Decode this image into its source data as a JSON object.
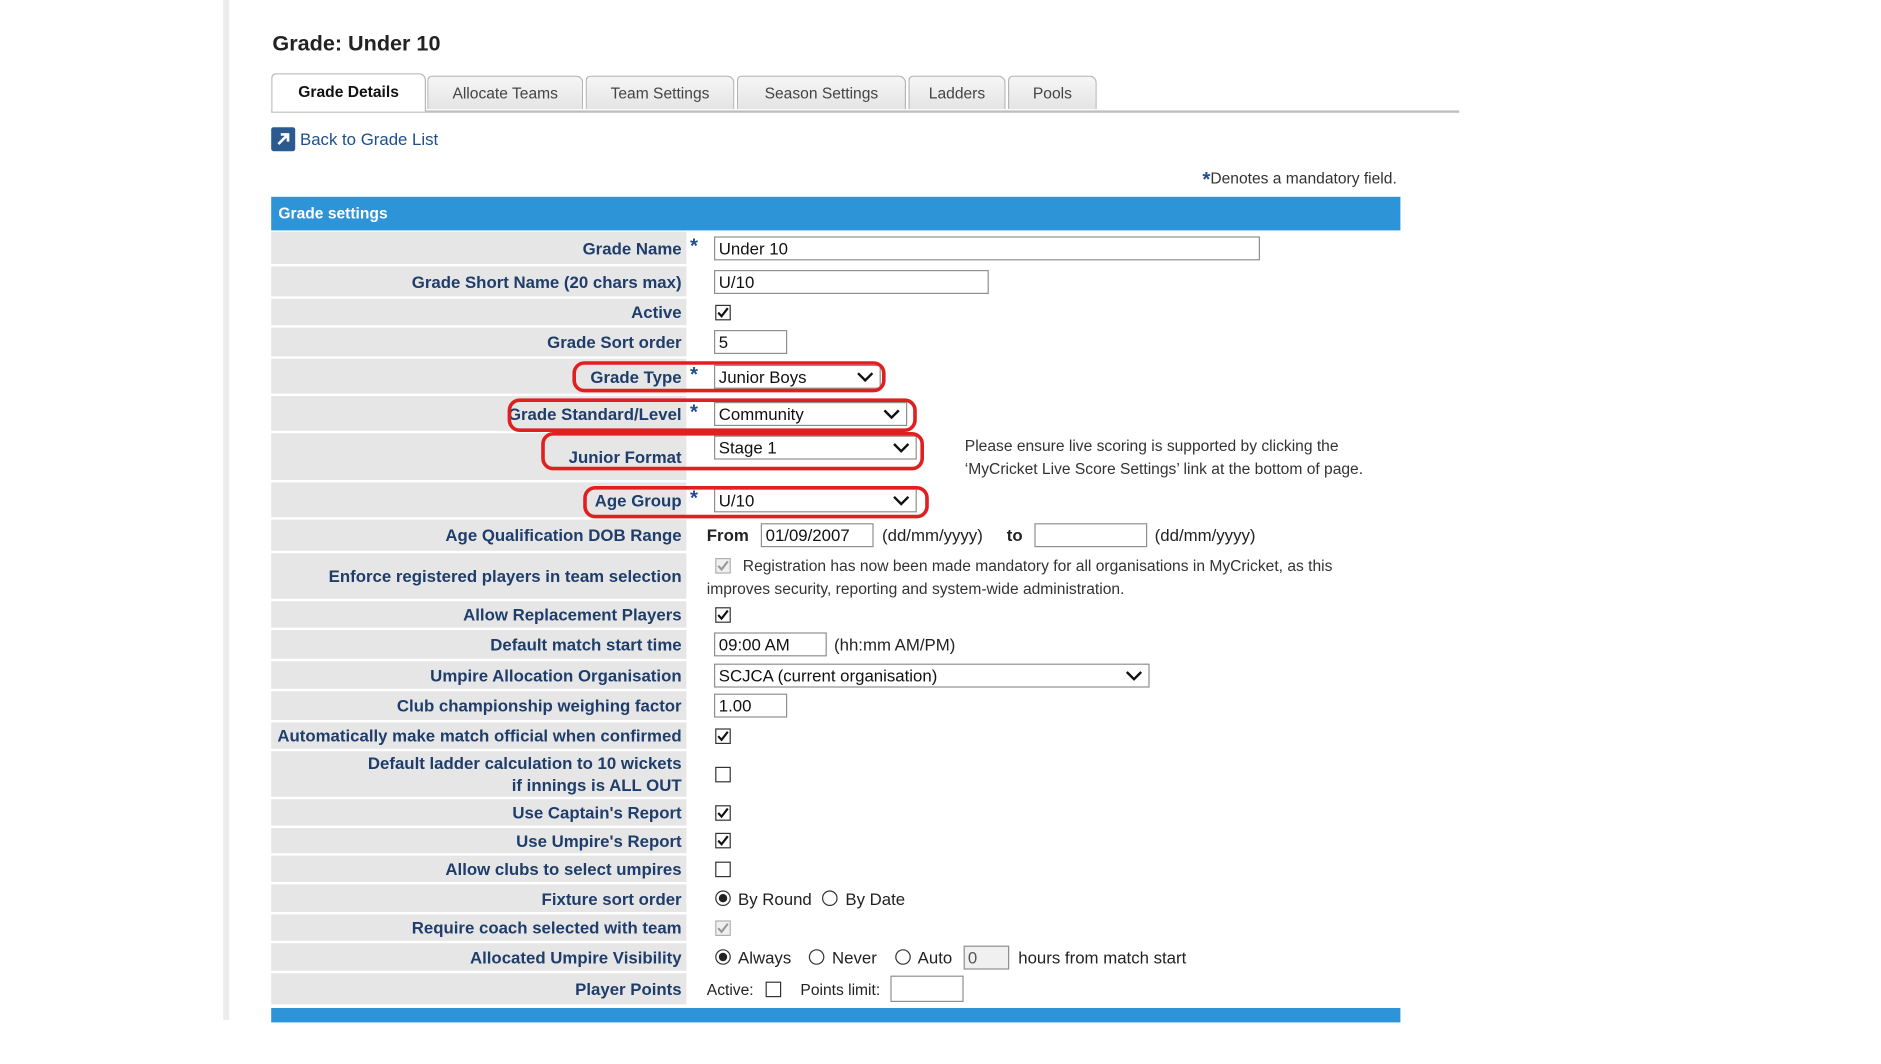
{
  "page": {
    "title": "Grade: Under 10"
  },
  "tabs": [
    {
      "label": "Grade Details",
      "active": true
    },
    {
      "label": "Allocate Teams",
      "active": false
    },
    {
      "label": "Team Settings",
      "active": false
    },
    {
      "label": "Season Settings",
      "active": false
    },
    {
      "label": "Ladders",
      "active": false
    },
    {
      "label": "Pools",
      "active": false
    }
  ],
  "back_link": {
    "label": "Back to Grade List",
    "icon": "external-link-icon"
  },
  "mandatory_note": {
    "star": "*",
    "text": "Denotes a mandatory field."
  },
  "section": {
    "title": "Grade settings"
  },
  "required_mark": "*",
  "colors": {
    "header_bg": "#2e94d8",
    "label_bg": "#e6e6e6",
    "label_text": "#1f3d6b",
    "highlight_oval": "#e02020"
  },
  "fields": {
    "grade_name": {
      "label": "Grade Name",
      "value": "Under 10",
      "required": true
    },
    "short_name": {
      "label": "Grade Short Name (20 chars max)",
      "value": "U/10"
    },
    "active": {
      "label": "Active",
      "checked": true
    },
    "sort_order": {
      "label": "Grade Sort order",
      "value": "5"
    },
    "grade_type": {
      "label": "Grade Type",
      "value": "Junior Boys",
      "required": true
    },
    "grade_standard": {
      "label": "Grade Standard/Level",
      "value": "Community",
      "required": true
    },
    "junior_format": {
      "label": "Junior Format",
      "value": "Stage 1",
      "note_line1": "Please ensure live scoring is supported by clicking the",
      "note_line2": "‘MyCricket Live Score Settings’ link at the bottom of page."
    },
    "age_group": {
      "label": "Age Group",
      "value": "U/10",
      "required": true
    },
    "dob_range": {
      "label": "Age Qualification DOB Range",
      "from_label": "From",
      "from_value": "01/09/2007",
      "from_hint": "(dd/mm/yyyy)",
      "to_label": "to",
      "to_value": "",
      "to_hint": "(dd/mm/yyyy)"
    },
    "enforce_registered": {
      "label": "Enforce registered players in team selection",
      "checked": true,
      "disabled": true,
      "text_line1": "Registration has now been made mandatory for all organisations in MyCricket, as this",
      "text_line2": "improves security, reporting and system-wide administration."
    },
    "allow_replacement": {
      "label": "Allow Replacement Players",
      "checked": true
    },
    "start_time": {
      "label": "Default match start time",
      "value": "09:00 AM",
      "hint": "(hh:mm AM/PM)"
    },
    "umpire_org": {
      "label": "Umpire Allocation Organisation",
      "value": "SCJCA (current organisation)"
    },
    "weighing_factor": {
      "label": "Club championship weighing factor",
      "value": "1.00"
    },
    "auto_official": {
      "label": "Automatically make match official when confirmed",
      "checked": true
    },
    "default_ladder": {
      "label_line1": "Default ladder calculation to 10 wickets",
      "label_line2": "if innings is ALL OUT",
      "checked": false
    },
    "captain_report": {
      "label": "Use Captain's Report",
      "checked": true
    },
    "umpire_report": {
      "label": "Use Umpire's Report",
      "checked": true
    },
    "clubs_select_umpires": {
      "label": "Allow clubs to select umpires",
      "checked": false
    },
    "fixture_sort": {
      "label": "Fixture sort order",
      "options": [
        "By Round",
        "By Date"
      ],
      "selected": "By Round"
    },
    "require_coach": {
      "label": "Require coach selected with team",
      "checked": true,
      "disabled": true
    },
    "umpire_visibility": {
      "label": "Allocated Umpire Visibility",
      "options": [
        "Always",
        "Never",
        "Auto"
      ],
      "selected": "Always",
      "hours_value": "0",
      "hours_suffix": "hours from match start"
    },
    "player_points": {
      "label": "Player Points",
      "active_label": "Active:",
      "active_checked": false,
      "limit_label": "Points limit:",
      "limit_value": ""
    }
  }
}
